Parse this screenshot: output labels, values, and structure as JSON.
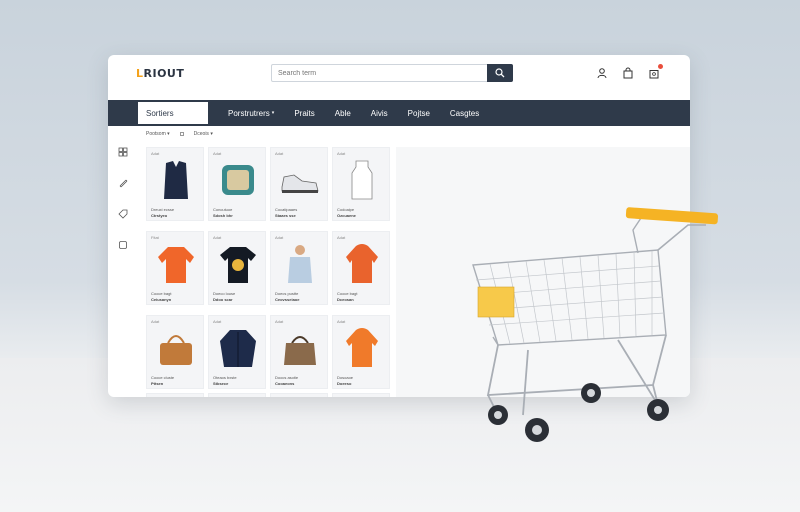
{
  "header": {
    "logo_text": "LRIOUT",
    "search": {
      "placeholder": "Search term"
    }
  },
  "nav": {
    "active_label": "Sortiers",
    "items": [
      "Porstrutrers",
      "Praits",
      "Able",
      "Aivis",
      "Pojtse",
      "Casgtes"
    ]
  },
  "filters": {
    "sort_label": "Pootsom",
    "view_label": "Dceois"
  },
  "products": [
    {
      "top": "Adat",
      "name": "Dreuxi ecsse",
      "price": "Ctrstyeo",
      "icon": "vest-icon",
      "color": "#1f2a44"
    },
    {
      "top": "Adat",
      "name": "Concutuoe",
      "price": "Sdosh bhr",
      "icon": "pillow-icon",
      "color": "#3a8a8c"
    },
    {
      "top": "Adat",
      "name": "Cocatipaaes",
      "price": "Staaes sse",
      "icon": "sneaker-icon",
      "color": "#e4e6ea"
    },
    {
      "top": "Adat",
      "name": "Codoaipe",
      "price": "Ozcuaene",
      "icon": "bottle-icon",
      "color": "#ffffff"
    },
    {
      "top": "Fitat",
      "name": "Cooce bagt",
      "price": "Ceiusanyn",
      "icon": "sweatshirt-icon",
      "color": "#f0662a"
    },
    {
      "top": "Adat",
      "name": "Doeco louse",
      "price": "Ddoo scar",
      "icon": "tshirt-icon",
      "color": "#141a24"
    },
    {
      "top": "Adat",
      "name": "Doecs pustte",
      "price": "Ceovsseiaoe",
      "icon": "model-icon",
      "color": "#b9cde1"
    },
    {
      "top": "Adat",
      "name": "Cooce bagt",
      "price": "Dceosan",
      "icon": "hoodie-icon",
      "color": "#e9632d"
    },
    {
      "top": "Adat",
      "name": "Cooce cluste",
      "price": "Pttsen",
      "icon": "handbag-icon",
      "color": "#c17a3a"
    },
    {
      "top": "Adat",
      "name": "Oteaos bxste",
      "price": "Stbsece",
      "icon": "jacket-icon",
      "color": "#1e2b4a"
    },
    {
      "top": "Adat",
      "name": "Doocs asotie",
      "price": "Cooaeons",
      "icon": "tote-icon",
      "color": "#8a6a4b"
    },
    {
      "top": "Adat",
      "name": "Dosoaoe",
      "price": "Doeeso",
      "icon": "orange-hoodie-icon",
      "color": "#f07a2a"
    }
  ],
  "colors": {
    "nav_bg": "#2f3a4a",
    "accent": "#f4a21b",
    "cart_handle": "#f5b324"
  }
}
